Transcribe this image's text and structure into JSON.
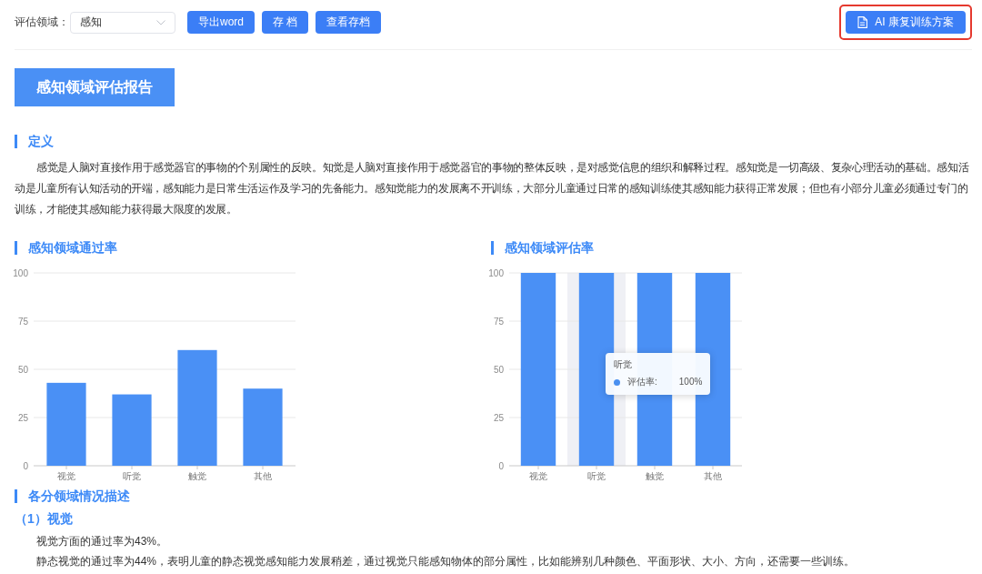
{
  "toolbar": {
    "domain_label": "评估领域：",
    "domain_select": {
      "value": "感知"
    },
    "buttons": [
      {
        "label": "导出word"
      },
      {
        "label": "存 档"
      },
      {
        "label": "查看存档"
      }
    ],
    "ai_button": {
      "label": "AI 康复训练方案",
      "highlighted": true
    }
  },
  "report_title": "感知领域评估报告",
  "definition": {
    "heading": "定义",
    "text": "感觉是人脑对直接作用于感觉器官的事物的个别属性的反映。知觉是人脑对直接作用于感觉器官的事物的整体反映，是对感觉信息的组织和解释过程。感知觉是一切高级、复杂心理活动的基础。感知活动是儿童所有认知活动的开端，感知能力是日常生活运作及学习的先备能力。感知觉能力的发展离不开训练，大部分儿童通过日常的感知训练使其感知能力获得正常发展；但也有小部分儿童必须通过专门的训练，才能使其感知能力获得最大限度的发展。"
  },
  "charts": [
    {
      "heading": "感知领域通过率",
      "chart_data": {
        "type": "bar",
        "categories": [
          "视觉",
          "听觉",
          "触觉",
          "其他"
        ],
        "values": [
          43,
          37,
          60,
          40
        ],
        "ylim": [
          0,
          100
        ],
        "yticks": [
          0,
          25,
          50,
          75,
          100
        ],
        "grid": true
      }
    },
    {
      "heading": "感知领域评估率",
      "chart_data": {
        "type": "bar",
        "categories": [
          "视觉",
          "听觉",
          "触觉",
          "其他"
        ],
        "values": [
          100,
          100,
          100,
          100
        ],
        "ylim": [
          0,
          100
        ],
        "yticks": [
          0,
          25,
          50,
          75,
          100
        ],
        "grid": true
      },
      "tooltip": {
        "title": "听觉",
        "series_label": "评估率:",
        "value": "100%",
        "color": "#4a90f0"
      }
    }
  ],
  "details": {
    "heading": "各分领域情况描述",
    "sections": [
      {
        "heading": "（1）视觉",
        "paragraphs": [
          "视觉方面的通过率为43%。",
          "静态视觉的通过率为44%，表明儿童的静态视觉感知能力发展稍差，通过视觉只能感知物体的部分属性，比如能辨别几种颜色、平面形状、大小、方向，还需要一些训练。"
        ]
      }
    ]
  }
}
